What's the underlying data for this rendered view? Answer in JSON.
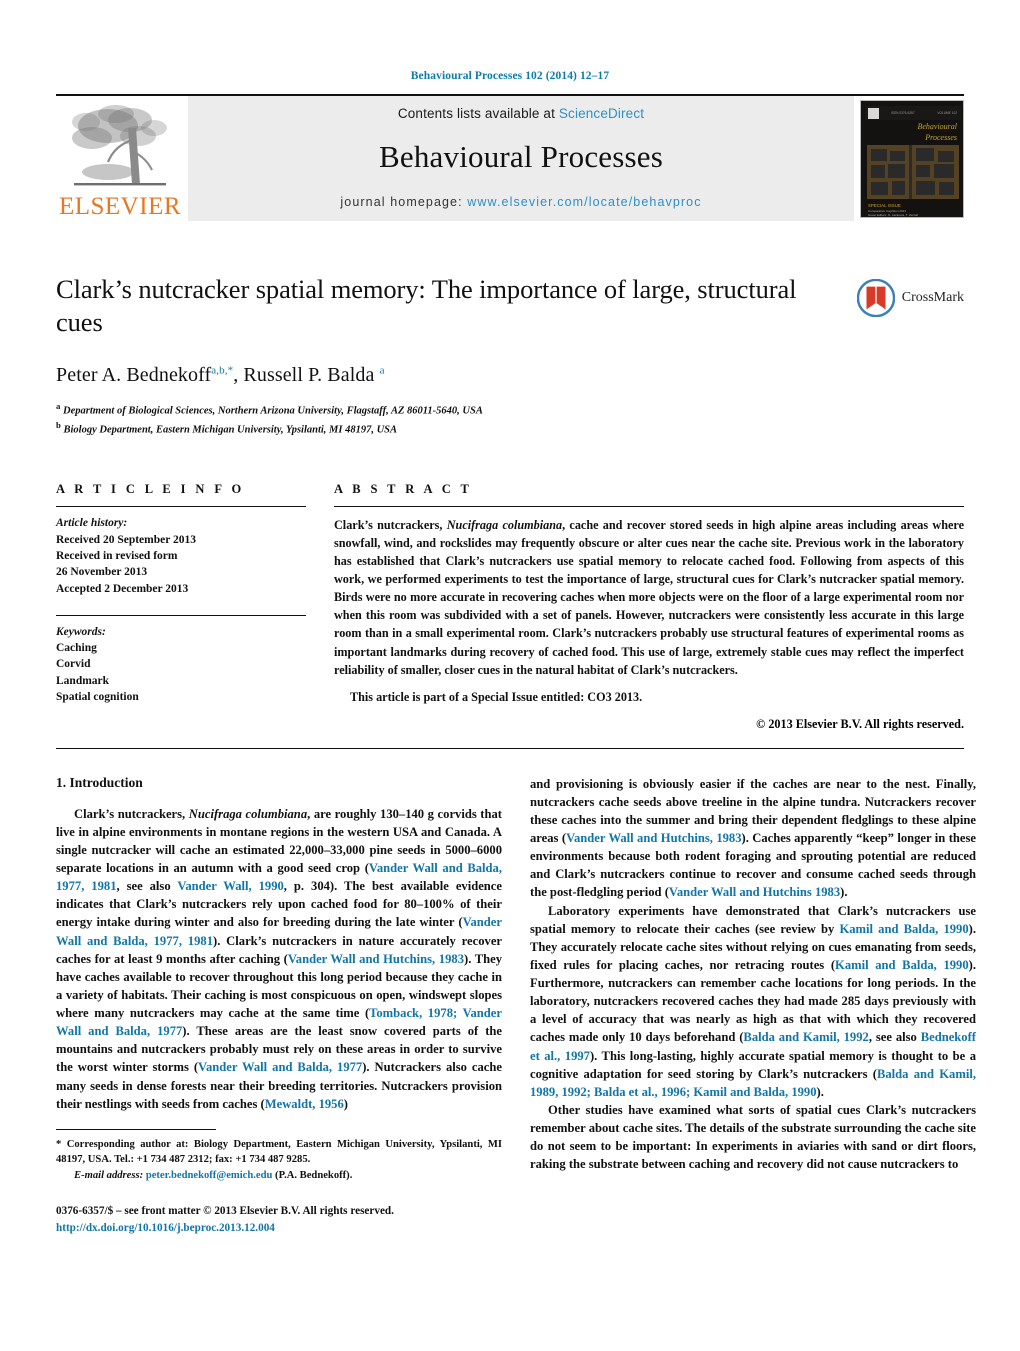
{
  "running_head": "Behavioural Processes 102 (2014) 12–17",
  "masthead": {
    "contents_prefix": "Contents lists available at ",
    "sciencedirect": "ScienceDirect",
    "journal_title": "Behavioural Processes",
    "homepage_label": "journal homepage: ",
    "homepage_url": "www.elsevier.com/locate/behavproc",
    "publisher_logo_text": "ELSEVIER",
    "cover_title_line1": "Behavioural",
    "cover_title_line2": "Processes",
    "accent_blue": "#2d8fc4",
    "elsevier_orange": "#E87722"
  },
  "article": {
    "title": "Clark’s nutcracker spatial memory: The importance of large, structural cues",
    "authors_html": "Peter A. Bednekoff<sup>a,b,</sup><sup class=\"ast\">*</sup>, Russell P. Balda <sup>a</sup>",
    "affiliation_a_marker": "a",
    "affiliation_a": "Department of Biological Sciences, Northern Arizona University, Flagstaff, AZ 86011-5640, USA",
    "affiliation_b_marker": "b",
    "affiliation_b": "Biology Department, Eastern Michigan University, Ypsilanti, MI 48197, USA",
    "crossmark_label": "CrossMark"
  },
  "article_info": {
    "heading": "A R T I C L E    I N F O",
    "history_label": "Article history:",
    "received": "Received 20 September 2013",
    "revised_label": "Received in revised form",
    "revised_date": "26 November 2013",
    "accepted": "Accepted 2 December 2013",
    "keywords_label": "Keywords:",
    "keywords": [
      "Caching",
      "Corvid",
      "Landmark",
      "Spatial cognition"
    ]
  },
  "abstract": {
    "heading": "A B S T R A C T",
    "body_html": "Clark’s nutcrackers, <i>Nucifraga columbiana</i>, cache and recover stored seeds in high alpine areas including areas where snowfall, wind, and rockslides may frequently obscure or alter cues near the cache site. Previous work in the laboratory has established that Clark’s nutcrackers use spatial memory to relocate cached food. Following from aspects of this work, we performed experiments to test the importance of large, structural cues for Clark’s nutcracker spatial memory. Birds were no more accurate in recovering caches when more objects were on the floor of a large experimental room nor when this room was subdivided with a set of panels. However, nutcrackers were consistently less accurate in this large room than in a small experimental room. Clark’s nutcrackers probably use structural features of experimental rooms as important landmarks during recovery of cached food. This use of large, extremely stable cues may reflect the imperfect reliability of smaller, closer cues in the natural habitat of Clark’s nutcrackers.",
    "special_issue": "This article is part of a Special Issue entitled: CO3 2013.",
    "copyright": "© 2013 Elsevier B.V. All rights reserved."
  },
  "main": {
    "section_heading": "1.  Introduction",
    "left_paragraphs_html": [
      "Clark’s nutcrackers, <i>Nucifraga columbiana</i>, are roughly 130–140 g corvids that live in alpine environments in montane regions in the western USA and Canada. A single nutcracker will cache an estimated 22,000–33,000 pine seeds in 5000–6000 separate locations in an autumn with a good seed crop (<span class=\"ref\">Vander Wall and Balda, 1977, 1981</span>, see also <span class=\"ref\">Vander Wall, 1990</span>, p. 304). The best available evidence indicates that Clark’s nutcrackers rely upon cached food for 80–100% of their energy intake during winter and also for breeding during the late winter (<span class=\"ref\">Vander Wall and Balda, 1977, 1981</span>). Clark’s nutcrackers in nature accurately recover caches for at least 9 months after caching (<span class=\"ref\">Vander Wall and Hutchins, 1983</span>). They have caches available to recover throughout this long period because they cache in a variety of habitats. Their caching is most conspicuous on open, windswept slopes where many nutcrackers may cache at the same time (<span class=\"ref\">Tomback, 1978; Vander Wall and Balda, 1977</span>). These areas are the least snow covered parts of the mountains and nutcrackers probably must rely on these areas in order to survive the worst winter storms (<span class=\"ref\">Vander Wall and Balda, 1977</span>). Nutcrackers also cache many seeds in dense forests near their breeding territories. Nutcrackers provision their nestlings with seeds from caches (<span class=\"ref\">Mewaldt, 1956</span>)"
    ],
    "right_paragraphs_html": [
      "and provisioning is obviously easier if the caches are near to the nest. Finally, nutcrackers cache seeds above treeline in the alpine tundra. Nutcrackers recover these caches into the summer and bring their dependent fledglings to these alpine areas (<span class=\"ref\">Vander Wall and Hutchins, 1983</span>). Caches apparently “keep” longer in these environments because both rodent foraging and sprouting potential are reduced and Clark’s nutcrackers continue to recover and consume cached seeds through the post-fledgling period (<span class=\"ref\">Vander Wall and Hutchins 1983</span>).",
      "Laboratory experiments have demonstrated that Clark’s nutcrackers use spatial memory to relocate their caches (see review by <span class=\"ref\">Kamil and Balda, 1990</span>). They accurately relocate cache sites without relying on cues emanating from seeds, fixed rules for placing caches, nor retracing routes (<span class=\"ref\">Kamil and Balda, 1990</span>). Furthermore, nutcrackers can remember cache locations for long periods. In the laboratory, nutcrackers recovered caches they had made 285 days previously with a level of accuracy that was nearly as high as that with which they recovered caches made only 10 days beforehand (<span class=\"ref\">Balda and Kamil, 1992</span>, see also <span class=\"ref\">Bednekoff et al., 1997</span>). This long-lasting, highly accurate spatial memory is thought to be a cognitive adaptation for seed storing by Clark’s nutcrackers (<span class=\"ref\">Balda and Kamil, 1989, 1992; Balda et al., 1996; Kamil and Balda, 1990</span>).",
      "Other studies have examined what sorts of spatial cues Clark’s nutcrackers remember about cache sites. The details of the substrate surrounding the cache site do not seem to be important: In experiments in aviaries with sand or dirt floors, raking the substrate between caching and recovery did not cause nutcrackers to"
    ]
  },
  "footnotes": {
    "corresponding_html": "<b>*</b>  Corresponding author at: Biology Department, Eastern Michigan University, Ypsilanti, MI 48197, USA. Tel.: +1 734 487 2312; fax: +1 734 487 9285.",
    "email_label": "E-mail address:",
    "email": "peter.bednekoff@emich.edu",
    "email_attrib": "(P.A. Bednekoff).",
    "issn_line": "0376-6357/$ – see front matter © 2013 Elsevier B.V. All rights reserved.",
    "doi": "http://dx.doi.org/10.1016/j.beproc.2013.12.004"
  }
}
